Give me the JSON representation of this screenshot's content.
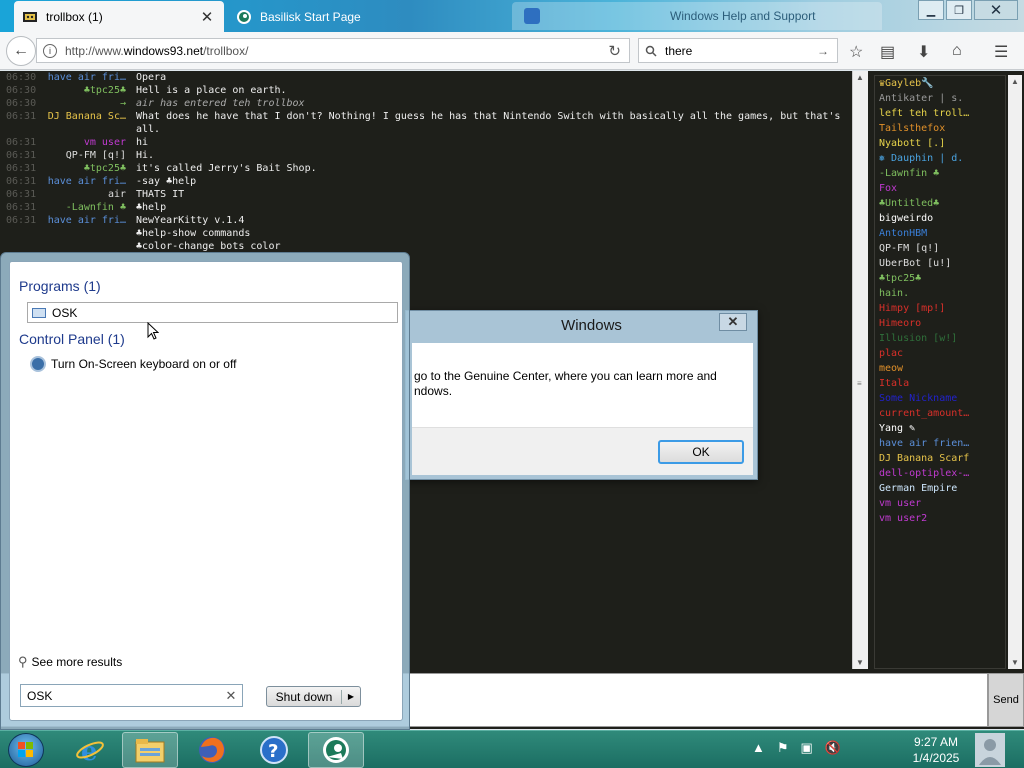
{
  "browser": {
    "tabs": [
      {
        "title": "trollbox (1)"
      },
      {
        "title": "Basilisk Start Page"
      },
      {
        "title": "Windows Help and Support"
      }
    ],
    "url_prefix": "http://www.",
    "url_domain": "windows93.net",
    "url_path": "/trollbox/",
    "search_value": "there"
  },
  "chat": {
    "messages": [
      {
        "time": "06:30",
        "nick": "have air fri…",
        "nick_color": "#5b8fd9",
        "text": "Opera"
      },
      {
        "time": "06:30",
        "nick": "♣tpc25♣",
        "nick_color": "#7fbf5f",
        "text": "Hell is a place on earth."
      },
      {
        "time": "06:30",
        "nick": "→",
        "nick_color": "#7fbf5f",
        "text": "air has entered teh trollbox",
        "italic": true
      },
      {
        "time": "06:31",
        "nick": "DJ Banana Sc…",
        "nick_color": "#e6c34a",
        "text": "What does he have that I don't? Nothing! I guess he has that Nintendo Switch with basically all the games, but that's all.",
        "tall": true
      },
      {
        "time": "06:31",
        "nick": "vm user",
        "nick_color": "#c03ad0",
        "text": "hi"
      },
      {
        "time": "06:31",
        "nick": "QP-FM [q!]",
        "nick_color": "#dddddd",
        "text": "Hi."
      },
      {
        "time": "06:31",
        "nick": "♣tpc25♣",
        "nick_color": "#7fbf5f",
        "text": "it's called Jerry's Bait Shop."
      },
      {
        "time": "06:31",
        "nick": "have air fri…",
        "nick_color": "#5b8fd9",
        "text": "-say ♣help"
      },
      {
        "time": "06:31",
        "nick": "air",
        "nick_color": "#dddddd",
        "text": "THATS IT"
      },
      {
        "time": "06:31",
        "nick": "-Lawnfin ♣",
        "nick_color": "#7fbf5f",
        "text": "♣help"
      },
      {
        "time": "06:31",
        "nick": "have air fri…",
        "nick_color": "#5b8fd9",
        "text": "NewYearKitty v.1.4"
      },
      {
        "time": "",
        "nick": "",
        "nick_color": "#dddddd",
        "text": "♣help-show commands"
      },
      {
        "time": "",
        "nick": "",
        "nick_color": "#dddddd",
        "text": "♣color-change bots color"
      }
    ],
    "send_label": "Send"
  },
  "users": [
    {
      "name": "♛Gayleb🔧",
      "color": "#e6c34a"
    },
    {
      "name": "Antikater | s.",
      "color": "#9a9a9a"
    },
    {
      "name": "left teh troll…",
      "color": "#e6d34a"
    },
    {
      "name": "Tailsthefox",
      "color": "#e0902a"
    },
    {
      "name": "Nyabott [.]",
      "color": "#e6d34a"
    },
    {
      "name": "❅ Dauphin | d.",
      "color": "#4aa3e0"
    },
    {
      "name": "-Lawnfin ♣",
      "color": "#7fbf5f"
    },
    {
      "name": "Fox",
      "color": "#c03ad0"
    },
    {
      "name": "♣Untitled♣",
      "color": "#7fbf5f"
    },
    {
      "name": "bigweirdo",
      "color": "#ffffff"
    },
    {
      "name": "AntonHBM",
      "color": "#3a7fd8"
    },
    {
      "name": "QP-FM [q!]",
      "color": "#dddddd"
    },
    {
      "name": "UberBot [u!]",
      "color": "#dddddd"
    },
    {
      "name": "♣tpc25♣",
      "color": "#7fbf5f"
    },
    {
      "name": "hain.",
      "color": "#7fbf5f"
    },
    {
      "name": "Himpy [mp!]",
      "color": "#d8302a"
    },
    {
      "name": "Himeoro",
      "color": "#d8302a"
    },
    {
      "name": "Illusion [w!]",
      "color": "#2f6f3a"
    },
    {
      "name": "plac",
      "color": "#d8302a"
    },
    {
      "name": "meow",
      "color": "#e0902a"
    },
    {
      "name": "Itala",
      "color": "#d8302a"
    },
    {
      "name": "Some Nickname",
      "color": "#2222cc"
    },
    {
      "name": "current_amount…",
      "color": "#d8302a"
    },
    {
      "name": "Yang ✎",
      "color": "#ffffff"
    },
    {
      "name": "have air frien…",
      "color": "#5b8fd9"
    },
    {
      "name": "DJ Banana Scarf",
      "color": "#e6c34a"
    },
    {
      "name": "dell-optiplex-…",
      "color": "#c03ad0"
    },
    {
      "name": "German Empire",
      "color": "#cfe8ff"
    },
    {
      "name": "vm user",
      "color": "#c03ad0"
    },
    {
      "name": "vm user2",
      "color": "#c03ad0"
    }
  ],
  "dialog": {
    "title": "Windows",
    "text_line1": "go to the Genuine Center, where you can learn more and",
    "text_line2": "ndows.",
    "ok_label": "OK",
    "accent": "#3c9be6"
  },
  "startmenu": {
    "programs_header": "Programs (1)",
    "program_item": "OSK",
    "cp_header": "Control Panel (1)",
    "cp_item": "Turn On-Screen keyboard on or off",
    "see_more": "See more results",
    "search_value": "OSK",
    "shutdown_label": "Shut down"
  },
  "taskbar": {
    "time": "9:27 AM",
    "date": "1/4/2025",
    "pinned": [
      "ie-icon",
      "explorer-icon",
      "firefox-icon",
      "help-icon",
      "basilisk-icon"
    ],
    "color": "#1f7466"
  }
}
